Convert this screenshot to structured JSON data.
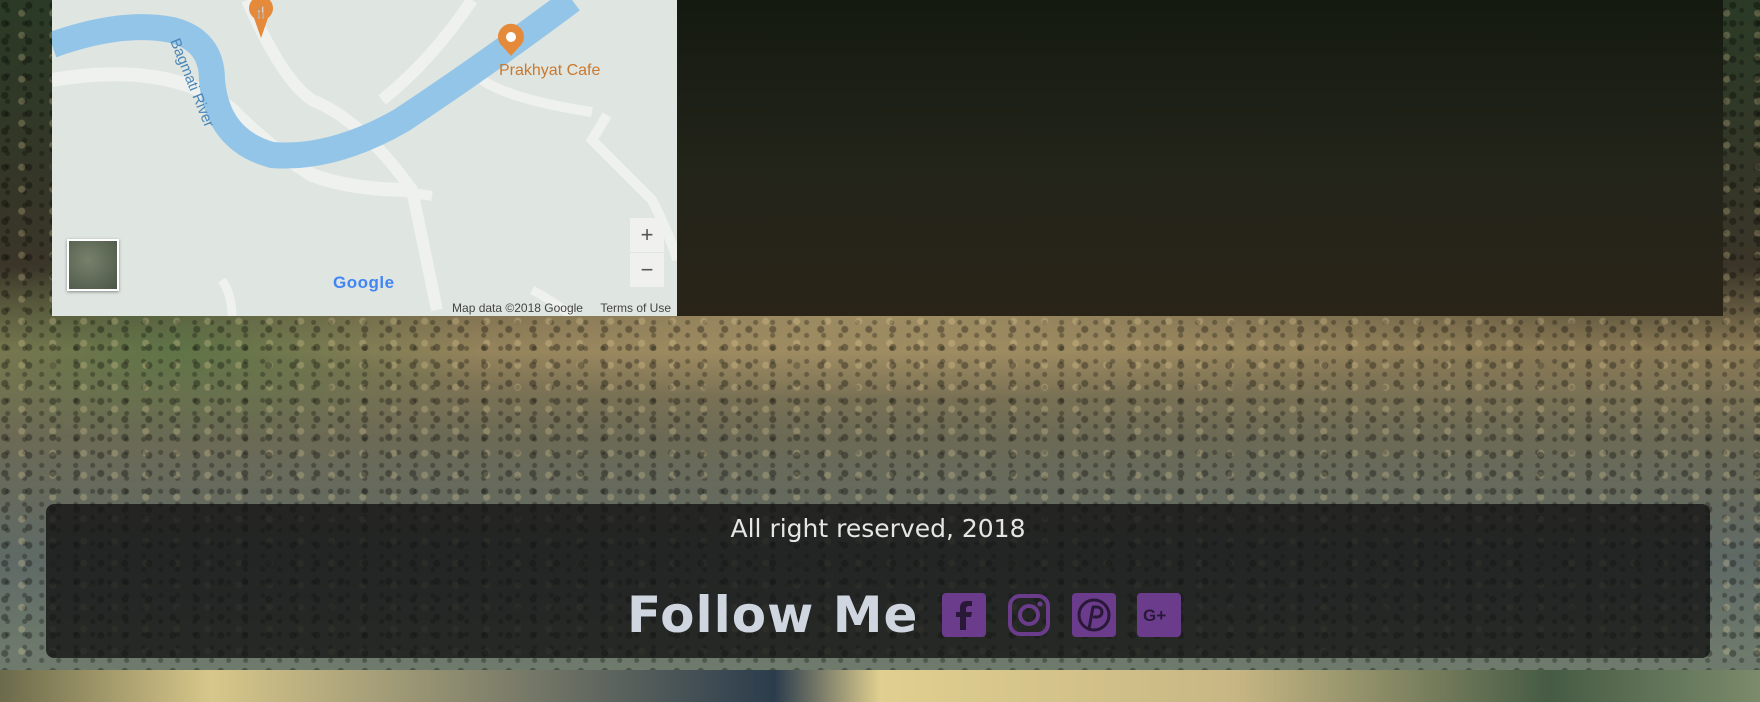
{
  "map": {
    "places": [
      {
        "name": "Prakhyat Cafe",
        "icon": "cafe-pin-icon"
      },
      {
        "name": "",
        "icon": "restaurant-pin-icon"
      }
    ],
    "river_label": "Bagmati River",
    "zoom_in": "+",
    "zoom_out": "−",
    "logo": "Google",
    "attribution": "Map data ©2018 Google",
    "terms": "Terms of Use"
  },
  "footer": {
    "copyright": "All right reserved, 2018",
    "follow_label": "Follow Me",
    "social": [
      {
        "name": "facebook-icon"
      },
      {
        "name": "instagram-icon"
      },
      {
        "name": "pinterest-icon"
      },
      {
        "name": "google-plus-icon"
      }
    ]
  },
  "colors": {
    "accent": "#6b3c8c",
    "river": "#92c5e8",
    "pin": "#e58a3a"
  }
}
